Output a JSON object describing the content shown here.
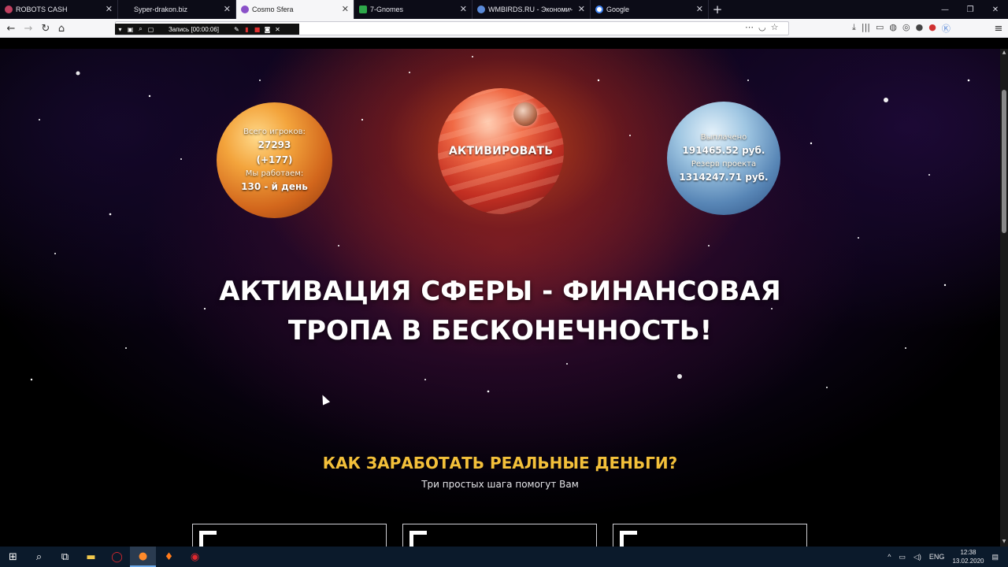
{
  "tabs": [
    {
      "label": "ROBOTS CASH",
      "icon": "robot-icon",
      "color": "#c04060",
      "active": false
    },
    {
      "label": "Syper-drakon.biz",
      "icon": "blank-icon",
      "color": "#0c0c17",
      "active": false
    },
    {
      "label": "Cosmo Sfera",
      "icon": "planet-icon",
      "color": "#8a50c8",
      "active": true
    },
    {
      "label": "7-Gnomes",
      "icon": "gnome-icon",
      "color": "#2ea84a",
      "active": false
    },
    {
      "label": "WMBIRDS.RU - Экономическ...",
      "icon": "bird-icon",
      "color": "#5a8ad8",
      "active": false
    },
    {
      "label": "Google",
      "icon": "google-icon",
      "color": "#ffffff",
      "active": false
    }
  ],
  "recorder": {
    "time": "Запись [00:00:06]"
  },
  "stats_left": {
    "players_label": "Всего игроков:",
    "players_value": "27293",
    "players_delta": "(+177)",
    "work_label": "Мы работаем:",
    "work_value": "130 - й день"
  },
  "activate_label": "АКТИВИРОВАТЬ",
  "stats_right": {
    "paid_label": "Выплачено",
    "paid_value": "191465.52 руб.",
    "reserve_label": "Резерв проекта",
    "reserve_value": "1314247.71 руб."
  },
  "hero": {
    "line1": "АКТИВАЦИЯ СФЕРЫ - ФИНАНСОВАЯ",
    "line2": "ТРОПА В БЕСКОНЕЧНОСТЬ!"
  },
  "howto": {
    "title": "КАК ЗАРАБОТАТЬ РЕАЛЬНЫЕ ДЕНЬГИ?",
    "subtitle": "Три простых шага помогут Вам"
  },
  "taskbar": {
    "lang": "ENG",
    "time": "12:38",
    "date": "13.02.2020"
  },
  "colors": {
    "accent_gold": "#f3c03a",
    "page_bg": "#000000"
  }
}
